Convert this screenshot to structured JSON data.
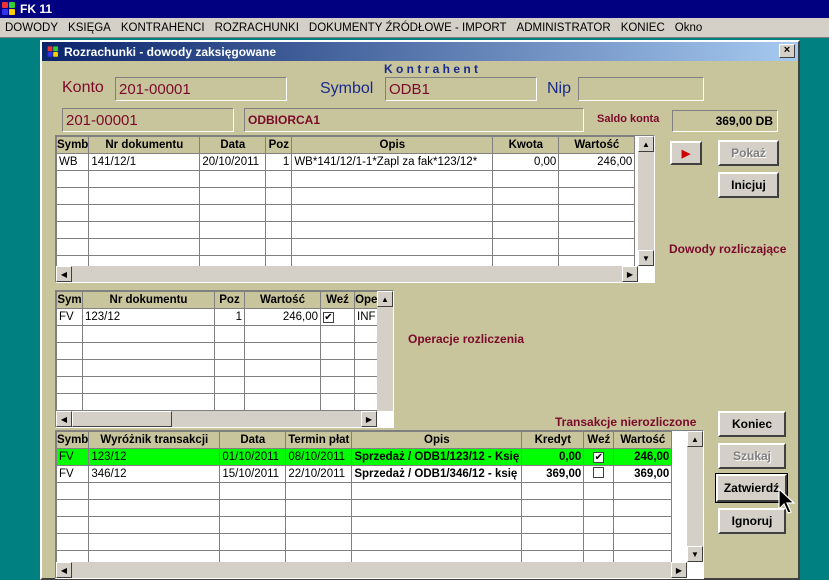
{
  "app": {
    "title": "FK 11"
  },
  "menu": [
    "DOWODY",
    "KSIĘGA",
    "KONTRAHENCI",
    "ROZRACHUNKI",
    "DOKUMENTY ŹRÓDŁOWE - IMPORT",
    "ADMINISTRATOR",
    "KONIEC",
    "Okno"
  ],
  "window": {
    "title": "Rozrachunki - dowody zaksięgowane",
    "close": "×"
  },
  "header": {
    "konto_label": "Konto",
    "konto_value": "201-00001",
    "kontrahent_label": "K o n t r a h e n t",
    "symbol_label": "Symbol",
    "symbol_value": "ODB1",
    "nip_label": "Nip",
    "nip_value": "",
    "account_code": "201-00001",
    "account_name": "ODBIORCA1",
    "saldo_label": "Saldo konta",
    "saldo_value": "369,00 DB"
  },
  "grid1": {
    "columns": [
      "Symb",
      "Nr dokumentu",
      "Data",
      "Poz",
      "Opis",
      "Kwota",
      "Wartość"
    ],
    "rows": [
      [
        "WB",
        "141/12/1",
        "20/10/2011",
        "1",
        "WB*141/12/1-1*Zapl za fak*123/12*",
        "0,00",
        "246,00"
      ]
    ]
  },
  "grid1_label": "Dowody rozliczające",
  "grid2": {
    "columns": [
      "Sym",
      "Nr dokumentu",
      "Poz",
      "Wartość",
      "Weź",
      "Ope"
    ],
    "rows": [
      [
        "FV",
        "123/12",
        "1",
        "246,00",
        "✔",
        "INF"
      ]
    ]
  },
  "grid2_label": "Operacje rozliczenia",
  "grid3_label": "Transakcje nierozliczone",
  "grid3": {
    "columns": [
      "Symb",
      "Wyróżnik transakcji",
      "Data",
      "Termin płat",
      "Opis",
      "Kredyt",
      "Weź",
      "Wartość"
    ],
    "rows": [
      [
        "FV",
        "123/12",
        "01/10/2011",
        "08/10/2011",
        "Sprzedaż / ODB1/123/12 - Księ",
        "0,00",
        "✔",
        "246,00"
      ],
      [
        "FV",
        "346/12",
        "15/10/2011",
        "22/10/2011",
        "Sprzedaż / ODB1/346/12 - księ",
        "369,00",
        "",
        "369,00"
      ]
    ]
  },
  "buttons": {
    "arrow": "▶",
    "pokaz": "Pokaż",
    "inicjuj": "Inicjuj",
    "koniec": "Koniec",
    "szukaj": "Szukaj",
    "zatwierdz": "Zatwierdź",
    "ignoruj": "Ignoruj"
  },
  "colors": {
    "highlight": "#00ff00",
    "label": "#7b0a2a",
    "panel": "#c8c49c"
  }
}
